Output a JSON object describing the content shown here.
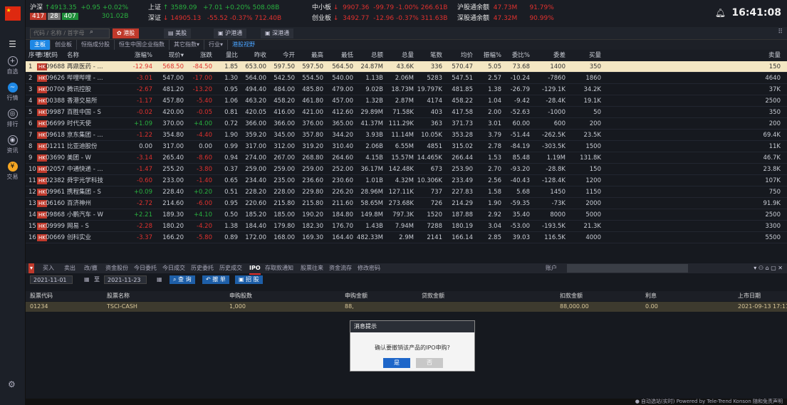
{
  "top": {
    "sh": {
      "name": "沪深",
      "arrow": "↑",
      "value": "4913.35",
      "chg": "+0.95",
      "pct": "+0.02%",
      "up": "417",
      "flat": "28",
      "down": "407",
      "amount": "301.02B"
    },
    "szh": {
      "name": "上证",
      "arrow": "↑",
      "value": "3589.09",
      "chg": "+7.01",
      "pct": "+0.20%",
      "amount": "508.08B"
    },
    "szc": {
      "name": "深证",
      "arrow": "↓",
      "value": "14905.13",
      "chg": "-55.52",
      "pct": "-0.37%",
      "amount": "712.40B"
    },
    "zxb": {
      "name": "中小板",
      "arrow": "↓",
      "value": "9907.36",
      "chg": "-99.79",
      "pct": "-1.00%",
      "amount": "266.61B"
    },
    "cyb": {
      "name": "创业板",
      "arrow": "↓",
      "value": "3492.77",
      "chg": "-12.96",
      "pct": "-0.37%",
      "amount": "311.63B"
    },
    "hgt": {
      "name": "沪股通余额",
      "value": "47.73M",
      "pct": "91.79%"
    },
    "sgt": {
      "name": "深股通余额",
      "value": "47.32M",
      "pct": "90.99%"
    },
    "time": "16:41:08"
  },
  "sidebar": [
    {
      "label": "自选",
      "icon": "plus-circle-icon"
    },
    {
      "label": "行情",
      "icon": "wave-icon"
    },
    {
      "label": "排行",
      "icon": "rank-icon"
    },
    {
      "label": "资讯",
      "icon": "news-icon"
    },
    {
      "label": "交易",
      "icon": "trade-icon"
    }
  ],
  "search_placeholder": "代码 / 名称 / 首字母",
  "market_tabs": [
    "港股",
    "美股",
    "沪港通",
    "深港通"
  ],
  "sub_tabs": [
    "主板",
    "创业板",
    "恒指成分股",
    "恒生中国企业指数",
    "其它指数▾",
    "行业▾",
    "港股视野"
  ],
  "headers": [
    "序号",
    "市场",
    "代码",
    "名称",
    "涨幅%",
    "现价▾",
    "涨跌",
    "量比",
    "昨收",
    "今开",
    "最高",
    "最低",
    "总额",
    "总量",
    "笔数",
    "均价",
    "振幅%",
    "委比%",
    "委差",
    "买量",
    "卖量"
  ],
  "rows": [
    [
      "1",
      "HK",
      "09688",
      "再鼎医药 - ...",
      "-12.94",
      "568.50",
      "-84.50",
      "1.85",
      "653.00",
      "597.50",
      "597.50",
      "564.50",
      "24.87M",
      "43.6K",
      "336",
      "570.47",
      "5.05",
      "73.68",
      "1400",
      "350",
      "150"
    ],
    [
      "2",
      "HK",
      "09626",
      "哔哩哔哩 - ...",
      "-3.01",
      "547.00",
      "-17.00",
      "1.30",
      "564.00",
      "542.50",
      "554.50",
      "540.00",
      "1.13B",
      "2.06M",
      "5283",
      "547.51",
      "2.57",
      "-10.24",
      "-7860",
      "1860",
      "4640"
    ],
    [
      "3",
      "HK",
      "00700",
      "腾讯控股",
      "-2.67",
      "481.20",
      "-13.20",
      "0.95",
      "494.40",
      "484.00",
      "485.80",
      "479.00",
      "9.02B",
      "18.73M",
      "19.797K",
      "481.85",
      "1.38",
      "-26.79",
      "-129.1K",
      "34.2K",
      "37K"
    ],
    [
      "4",
      "HK",
      "00388",
      "香港交易所",
      "-1.17",
      "457.80",
      "-5.40",
      "1.06",
      "463.20",
      "458.20",
      "461.80",
      "457.00",
      "1.32B",
      "2.87M",
      "4174",
      "458.22",
      "1.04",
      "-9.42",
      "-28.4K",
      "19.1K",
      "2500"
    ],
    [
      "5",
      "HK",
      "09987",
      "百胜中国 - S",
      "-0.02",
      "420.00",
      "-0.05",
      "0.81",
      "420.05",
      "416.00",
      "421.00",
      "412.60",
      "29.89M",
      "71.58K",
      "403",
      "417.58",
      "2.00",
      "-52.63",
      "-1000",
      "50",
      "350"
    ],
    [
      "6",
      "HK",
      "06699",
      "时代天使",
      "+1.09",
      "370.00",
      "+4.00",
      "0.72",
      "366.00",
      "366.00",
      "376.00",
      "365.00",
      "41.37M",
      "111.29K",
      "363",
      "371.73",
      "3.01",
      "60.00",
      "600",
      "200",
      "200"
    ],
    [
      "7",
      "HK",
      "09618",
      "京东集团 - ...",
      "-1.22",
      "354.80",
      "-4.40",
      "1.90",
      "359.20",
      "345.00",
      "357.80",
      "344.20",
      "3.93B",
      "11.14M",
      "10.05K",
      "353.28",
      "3.79",
      "-51.44",
      "-262.5K",
      "23.5K",
      "69.4K"
    ],
    [
      "8",
      "HK",
      "01211",
      "比亚迪股份",
      "0.00",
      "317.00",
      "0.00",
      "0.99",
      "317.00",
      "312.00",
      "319.20",
      "310.40",
      "2.06B",
      "6.55M",
      "4851",
      "315.02",
      "2.78",
      "-84.19",
      "-303.5K",
      "1500",
      "11K"
    ],
    [
      "9",
      "HK",
      "03690",
      "美团 - W",
      "-3.14",
      "265.40",
      "-8.60",
      "0.94",
      "274.00",
      "267.00",
      "268.80",
      "264.60",
      "4.15B",
      "15.57M",
      "14.465K",
      "266.44",
      "1.53",
      "85.48",
      "1.19M",
      "131.8K",
      "46.7K"
    ],
    [
      "10",
      "HK",
      "02057",
      "中通快递 - ...",
      "-1.47",
      "255.20",
      "-3.80",
      "0.37",
      "259.00",
      "259.00",
      "259.00",
      "252.00",
      "36.17M",
      "142.48K",
      "673",
      "253.90",
      "2.70",
      "-93.20",
      "-28.8K",
      "150",
      "23.8K"
    ],
    [
      "11",
      "HK",
      "02382",
      "舜宇光学科技",
      "-0.60",
      "233.00",
      "-1.40",
      "0.65",
      "234.40",
      "235.00",
      "236.60",
      "230.60",
      "1.01B",
      "4.32M",
      "10.306K",
      "233.49",
      "2.56",
      "-40.43",
      "-128.4K",
      "1200",
      "107K"
    ],
    [
      "12",
      "HK",
      "09961",
      "携程集团 - S",
      "+0.09",
      "228.40",
      "+0.20",
      "0.51",
      "228.20",
      "228.00",
      "229.80",
      "226.20",
      "28.96M",
      "127.11K",
      "737",
      "227.83",
      "1.58",
      "5.68",
      "1450",
      "1150",
      "750"
    ],
    [
      "13",
      "HK",
      "06160",
      "百济神州",
      "-2.72",
      "214.60",
      "-6.00",
      "0.95",
      "220.60",
      "215.80",
      "215.80",
      "211.60",
      "58.65M",
      "273.68K",
      "726",
      "214.29",
      "1.90",
      "-59.35",
      "-73K",
      "2000",
      "91.9K"
    ],
    [
      "14",
      "HK",
      "09868",
      "小鹏汽车 - W",
      "+2.21",
      "189.30",
      "+4.10",
      "0.50",
      "185.20",
      "185.00",
      "190.20",
      "184.80",
      "149.8M",
      "797.3K",
      "1520",
      "187.88",
      "2.92",
      "35.40",
      "8000",
      "5000",
      "2500"
    ],
    [
      "15",
      "HK",
      "09999",
      "网易 - S",
      "-2.28",
      "180.20",
      "-4.20",
      "1.38",
      "184.40",
      "179.80",
      "182.30",
      "176.70",
      "1.43B",
      "7.94M",
      "7288",
      "180.19",
      "3.04",
      "-53.00",
      "-193.5K",
      "21.3K",
      "3300"
    ],
    [
      "16",
      "HK",
      "00669",
      "创科实业",
      "-3.37",
      "166.20",
      "-5.80",
      "0.89",
      "172.00",
      "168.00",
      "169.30",
      "164.40",
      "482.33M",
      "2.9M",
      "2141",
      "166.14",
      "2.85",
      "39.03",
      "116.5K",
      "4000",
      "5500"
    ]
  ],
  "bottom_tabs": [
    "买入",
    "卖出",
    "改/撤",
    "资金股份",
    "今日委托",
    "今日成交",
    "历史委托",
    "历史成交",
    "IPO",
    "存取款通知",
    "股票往来",
    "资金流存",
    "修改密码"
  ],
  "account_label": "账户",
  "filter": {
    "from": "2021-11-01",
    "to_label": "至",
    "to": "2021-11-23",
    "query": "查 询",
    "cancel": "撤 单",
    "revoke": "招 股"
  },
  "ipo_headers": [
    "股票代码",
    "股票名称",
    "申购股数",
    "申购金额",
    "贷款金额",
    "扣款金额",
    "利息",
    "上市日期"
  ],
  "ipo_row": [
    "01234",
    "TSCI-CASH",
    "1,000",
    "88,",
    "",
    "88,000.00",
    "0.00",
    "2021-09-13 17:11:53"
  ],
  "modal": {
    "title": "消息提示",
    "message": "确认要撤销该产品的IPO申购?",
    "ok": "是",
    "cancel": "否"
  },
  "status": "● 自动选站(实时)  Powered by Tele-Trend Konson  随和免责声明"
}
